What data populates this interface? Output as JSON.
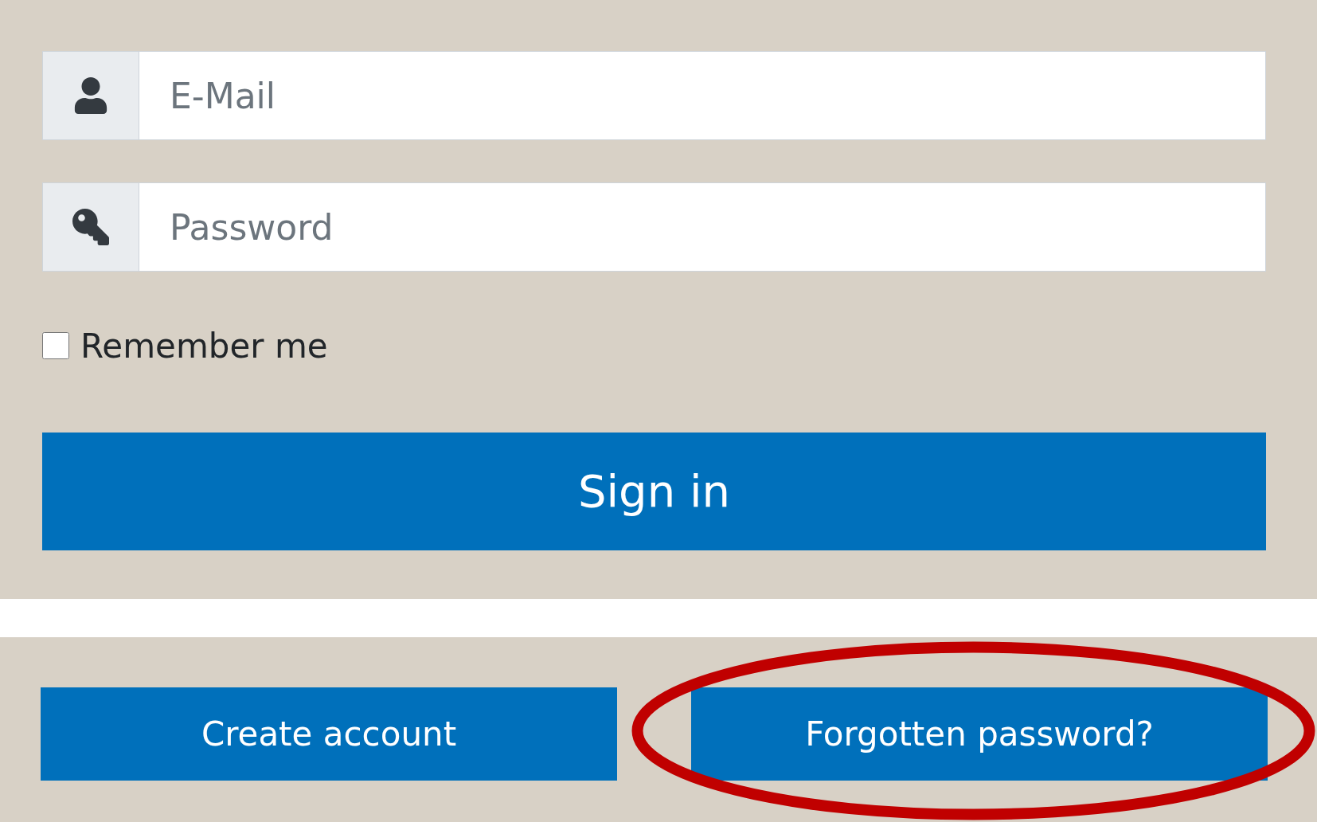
{
  "email_field": {
    "placeholder": "E-Mail"
  },
  "password_field": {
    "placeholder": "Password"
  },
  "remember": {
    "label": "Remember me",
    "checked": false
  },
  "sign_in_button": {
    "label": "Sign in"
  },
  "bottom_buttons": [
    {
      "label": "Create account",
      "highlighted": false
    },
    {
      "label": "Forgotten password?",
      "highlighted": true
    }
  ]
}
